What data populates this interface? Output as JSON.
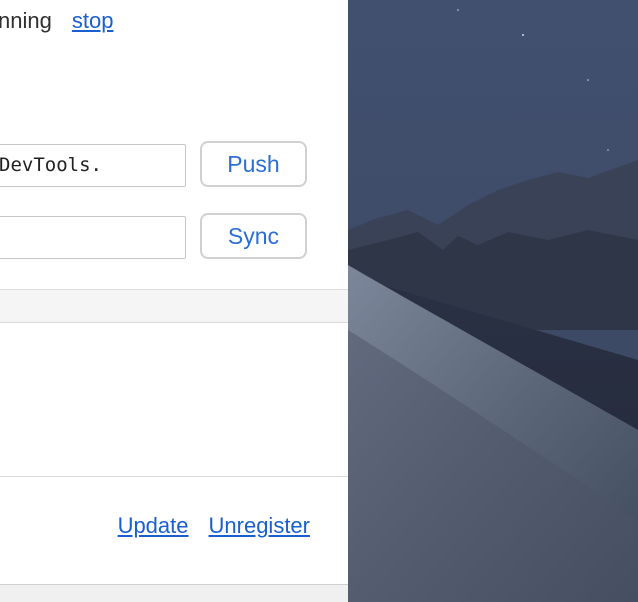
{
  "worker": {
    "status_text": "nning",
    "stop_label": "stop"
  },
  "push": {
    "input_value": "DevTools.",
    "button_label": "Push"
  },
  "sync": {
    "input_value": "",
    "button_label": "Sync"
  },
  "actions": {
    "update_label": "Update",
    "unregister_label": "Unregister"
  },
  "colors": {
    "link": "#1a5fd0",
    "button_text": "#2a6ed6",
    "sky": "#3d4a63",
    "dune": "#6a7488"
  }
}
